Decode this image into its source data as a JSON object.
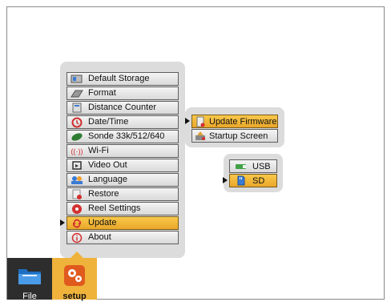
{
  "main_menu": {
    "items": [
      {
        "label": "Default Storage",
        "icon": "storage-icon"
      },
      {
        "label": "Format",
        "icon": "format-icon"
      },
      {
        "label": "Distance Counter",
        "icon": "calculator-icon"
      },
      {
        "label": "Date/Time",
        "icon": "clock-icon"
      },
      {
        "label": "Sonde 33k/512/640",
        "icon": "sonde-icon"
      },
      {
        "label": "Wi-Fi",
        "icon": "wifi-icon"
      },
      {
        "label": "Video Out",
        "icon": "video-out-icon"
      },
      {
        "label": "Language",
        "icon": "language-icon"
      },
      {
        "label": "Restore",
        "icon": "restore-icon"
      },
      {
        "label": "Reel Settings",
        "icon": "reel-icon"
      },
      {
        "label": "Update",
        "icon": "update-icon",
        "selected": true
      },
      {
        "label": "About",
        "icon": "info-icon"
      }
    ]
  },
  "update_submenu": {
    "items": [
      {
        "label": "Update Firmware",
        "icon": "firmware-icon",
        "selected": true
      },
      {
        "label": "Startup Screen",
        "icon": "startup-screen-icon"
      }
    ]
  },
  "source_submenu": {
    "items": [
      {
        "label": "USB",
        "icon": "usb-icon"
      },
      {
        "label": "SD",
        "icon": "sd-card-icon",
        "selected": true
      }
    ]
  },
  "bottom_tabs": {
    "file_label": "File",
    "setup_label": "setup"
  },
  "colors": {
    "highlight": "#efb33c",
    "panel": "#dcdcdc",
    "tab_dark": "#2d2d2d"
  }
}
